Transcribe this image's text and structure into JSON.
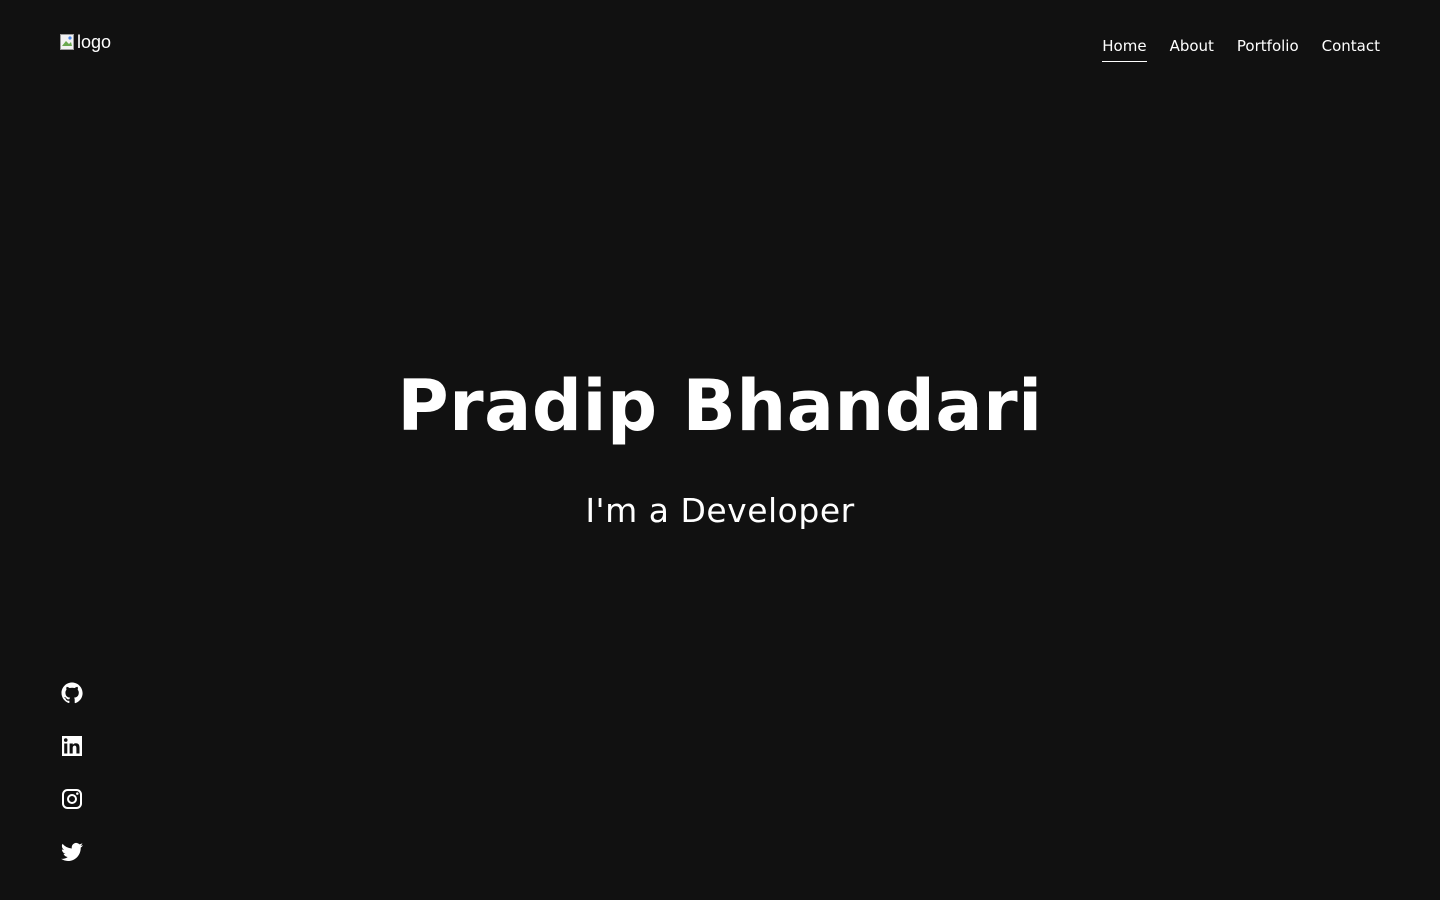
{
  "header": {
    "logo_alt": "logo",
    "nav": [
      {
        "label": "Home",
        "active": true
      },
      {
        "label": "About",
        "active": false
      },
      {
        "label": "Portfolio",
        "active": false
      },
      {
        "label": "Contact",
        "active": false
      }
    ]
  },
  "hero": {
    "name": "Pradip Bhandari",
    "role": "I'm a Developer"
  },
  "social": [
    {
      "icon": "github-icon"
    },
    {
      "icon": "linkedin-icon"
    },
    {
      "icon": "instagram-icon"
    },
    {
      "icon": "twitter-icon"
    }
  ],
  "colors": {
    "background": "#111111",
    "text": "#ffffff"
  }
}
